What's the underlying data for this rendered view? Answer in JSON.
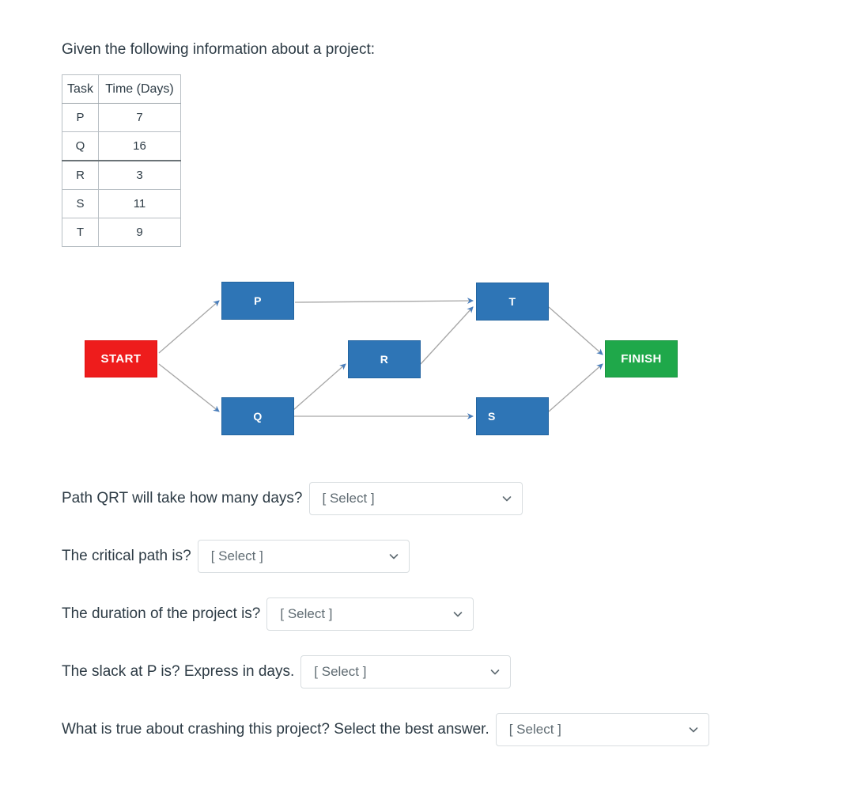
{
  "intro": "Given the following information about a project:",
  "table": {
    "headers": [
      "Task",
      "Time (Days)"
    ],
    "rows": [
      {
        "task": "P",
        "time": "7"
      },
      {
        "task": "Q",
        "time": "16"
      },
      {
        "task": "R",
        "time": "3"
      },
      {
        "task": "S",
        "time": "11"
      },
      {
        "task": "T",
        "time": "9"
      }
    ]
  },
  "diagram": {
    "nodes": {
      "start": "START",
      "finish": "FINISH",
      "p": "P",
      "q": "Q",
      "r": "R",
      "s": "S",
      "t": "T"
    },
    "edges": [
      "START->P",
      "START->Q",
      "Q->R",
      "P->T",
      "R->T",
      "Q->S",
      "T->FINISH",
      "S->FINISH"
    ],
    "colors": {
      "start": "#ee1c1c",
      "finish": "#1fa84a",
      "task": "#2e75b6",
      "edge": "#a6a6a6",
      "arrowhead": "#4a7ebb"
    }
  },
  "questions": [
    {
      "label": "Path QRT will take how many days?",
      "value": "[ Select ]"
    },
    {
      "label": "The critical path is?",
      "value": "[ Select ]"
    },
    {
      "label": "The duration of the project is?",
      "value": "[ Select ]"
    },
    {
      "label": "The slack at P is? Express in days.",
      "value": "[ Select ]"
    },
    {
      "label": "What is true about crashing this project? Select the best answer.",
      "value": "[ Select ]"
    }
  ]
}
